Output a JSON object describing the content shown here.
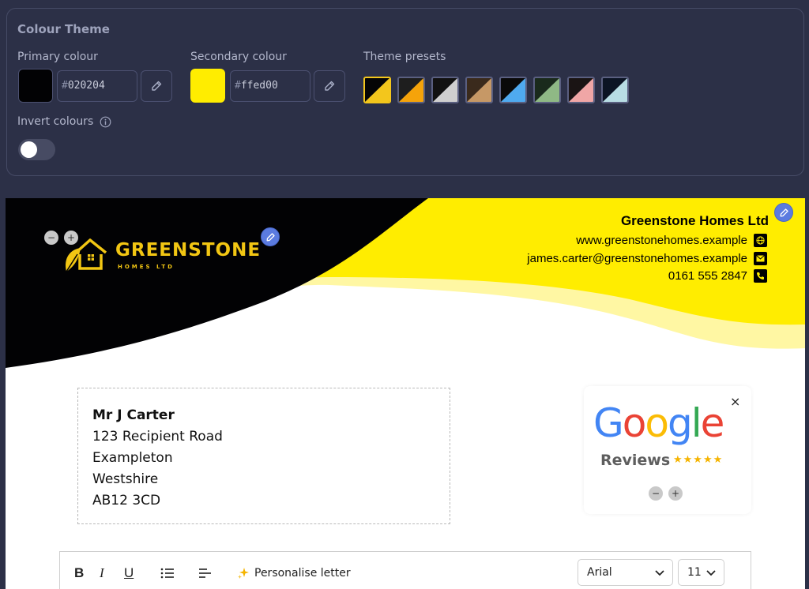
{
  "theme": {
    "title": "Colour Theme",
    "primary": {
      "label": "Primary colour",
      "hex": "#020204",
      "color": "#020204"
    },
    "secondary": {
      "label": "Secondary colour",
      "hex": "#ffed00",
      "color": "#ffed00"
    },
    "presets_label": "Theme presets",
    "presets": [
      {
        "a": "#050505",
        "b": "#f3c61c"
      },
      {
        "a": "#1e1e1e",
        "b": "#f5a30a"
      },
      {
        "a": "#111111",
        "b": "#cfcfcf"
      },
      {
        "a": "#3a2a1c",
        "b": "#c69866"
      },
      {
        "a": "#0a0a0a",
        "b": "#4faaf0"
      },
      {
        "a": "#1a2a1c",
        "b": "#8fb985"
      },
      {
        "a": "#1a1414",
        "b": "#f0a6a6"
      },
      {
        "a": "#0c1424",
        "b": "#b8dde4"
      }
    ],
    "invert_label": "Invert colours",
    "invert_on": false
  },
  "letter": {
    "logo": {
      "main": "GREENSTONE",
      "sub": "HOMES LTD"
    },
    "company_name": "Greenstone Homes Ltd",
    "website": "www.greenstonehomes.example",
    "email": "james.carter@greenstonehomes.example",
    "phone": "0161 555 2847",
    "recipient": {
      "name": "Mr J Carter",
      "line1": "123 Recipient Road",
      "line2": "Exampleton",
      "line3": "Westshire",
      "postcode": "AB12 3CD"
    },
    "reviews": {
      "brand": "Google",
      "word": "Reviews",
      "stars": "★★★★★"
    }
  },
  "editor": {
    "bold": "B",
    "italic": "I",
    "underline": "U",
    "personalise_label": "Personalise letter",
    "font": "Arial",
    "size": "11"
  },
  "controls": {
    "minus": "−",
    "plus": "+",
    "close": "×"
  }
}
